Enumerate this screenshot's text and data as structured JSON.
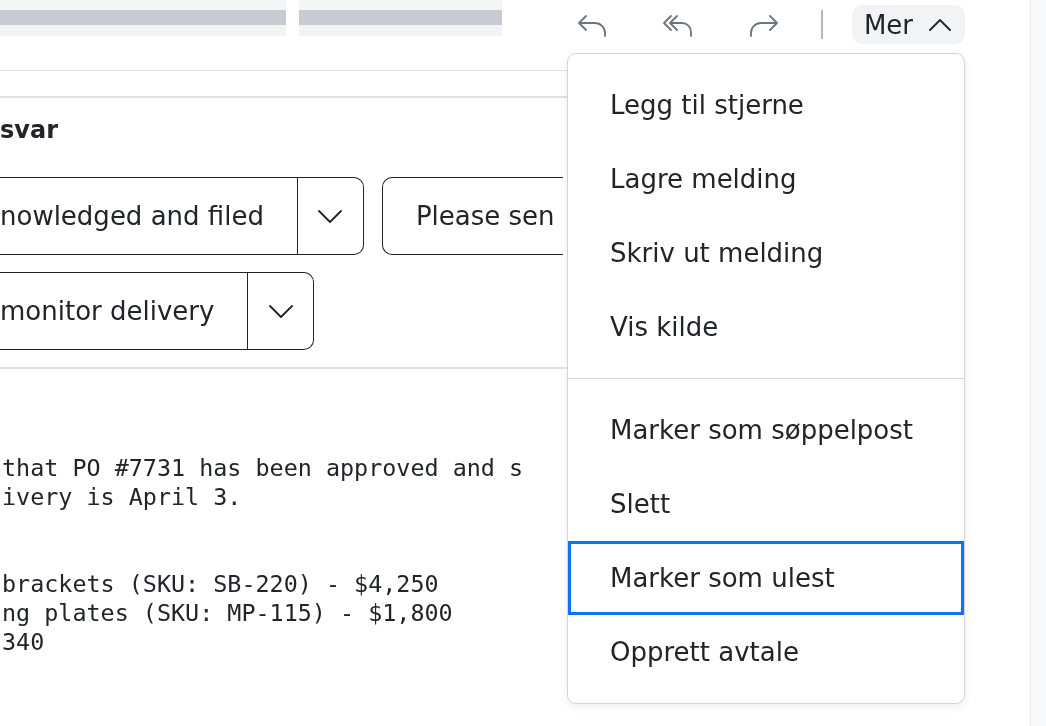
{
  "more_button": {
    "label": "Mer",
    "expanded": true
  },
  "quick_replies": {
    "title": "svar",
    "rows": [
      [
        {
          "kind": "split",
          "label": "nowledged and filed"
        },
        {
          "kind": "plain",
          "label": "Please sen"
        }
      ],
      [
        {
          "kind": "split",
          "label": "monitor delivery"
        }
      ]
    ]
  },
  "message_body": {
    "paragraphs": [
      [
        "that PO #7731 has been approved and s",
        "ivery is April 3."
      ],
      [
        "brackets (SKU: SB-220) - $4,250",
        "ng plates (SKU: MP-115) - $1,800",
        "340"
      ]
    ]
  },
  "menu": {
    "groups": [
      {
        "items": [
          {
            "label": "Legg til stjerne",
            "selected": false
          },
          {
            "label": "Lagre melding",
            "selected": false
          },
          {
            "label": "Skriv ut melding",
            "selected": false
          },
          {
            "label": "Vis kilde",
            "selected": false
          }
        ]
      },
      {
        "items": [
          {
            "label": "Marker som søppelpost",
            "selected": false
          },
          {
            "label": "Slett",
            "selected": false
          },
          {
            "label": "Marker som ulest",
            "selected": true
          },
          {
            "label": "Opprett avtale",
            "selected": false
          }
        ]
      }
    ]
  }
}
